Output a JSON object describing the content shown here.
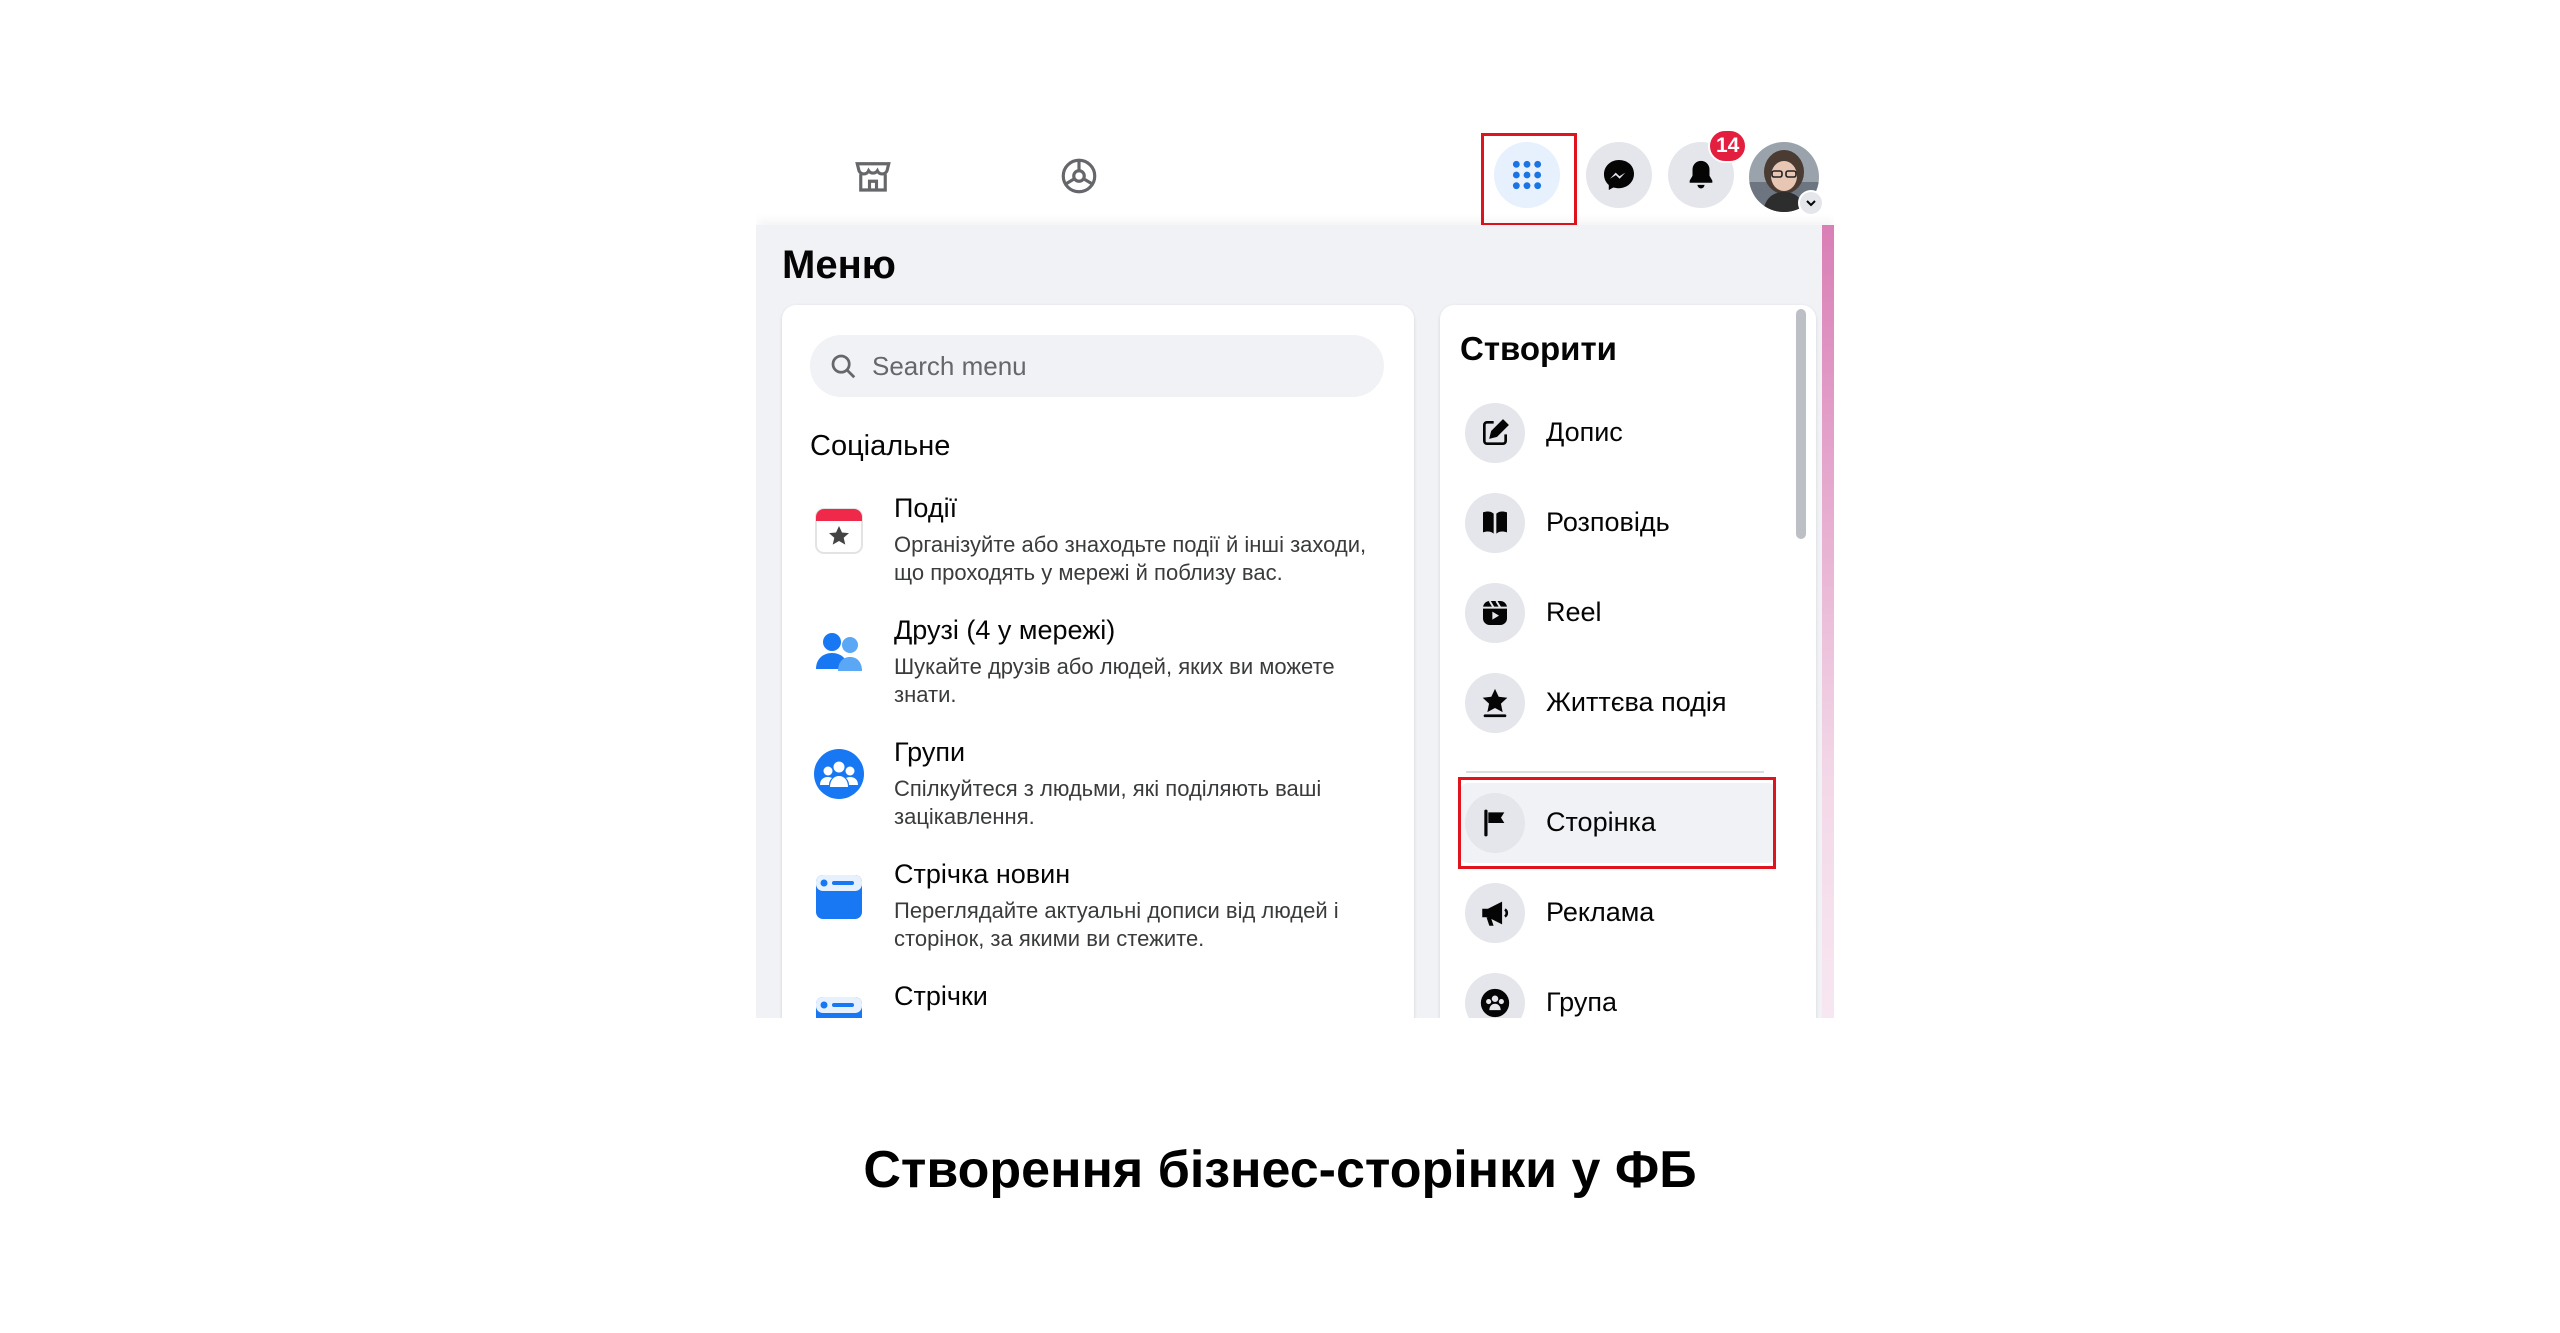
{
  "menu_title": "Меню",
  "search": {
    "placeholder": "Search menu"
  },
  "social": {
    "title": "Соціальне",
    "items": [
      {
        "title": "Події",
        "desc": "Організуйте або знаходьте події й інші заходи, що проходять у мережі й поблизу вас.",
        "icon": "events-calendar-icon"
      },
      {
        "title": "Друзі (4 у мережі)",
        "desc": "Шукайте друзів або людей, яких ви можете знати.",
        "icon": "friends-icon"
      },
      {
        "title": "Групи",
        "desc": "Спілкуйтеся з людьми, які поділяють ваші зацікавлення.",
        "icon": "groups-icon"
      },
      {
        "title": "Стрічка новин",
        "desc": "Переглядайте актуальні дописи від людей і сторінок, за якими ви стежите.",
        "icon": "news-feed-icon"
      },
      {
        "title": "Стрічки",
        "desc": "",
        "icon": "feeds-icon"
      }
    ]
  },
  "create": {
    "title": "Створити",
    "items": [
      {
        "label": "Допис",
        "icon": "post-edit-icon"
      },
      {
        "label": "Розповідь",
        "icon": "story-book-icon"
      },
      {
        "label": "Reel",
        "icon": "reel-icon"
      },
      {
        "label": "Життєва подія",
        "icon": "life-event-star-icon"
      },
      {
        "label": "Сторінка",
        "icon": "page-flag-icon"
      },
      {
        "label": "Реклама",
        "icon": "ad-megaphone-icon"
      },
      {
        "label": "Група",
        "icon": "group-icon"
      }
    ]
  },
  "notifications_count": "14",
  "caption": "Створення бізнес-сторінки у ФБ",
  "colors": {
    "highlight": "#e0141e",
    "badge": "#e41e3f",
    "blue": "#1b74e4"
  }
}
